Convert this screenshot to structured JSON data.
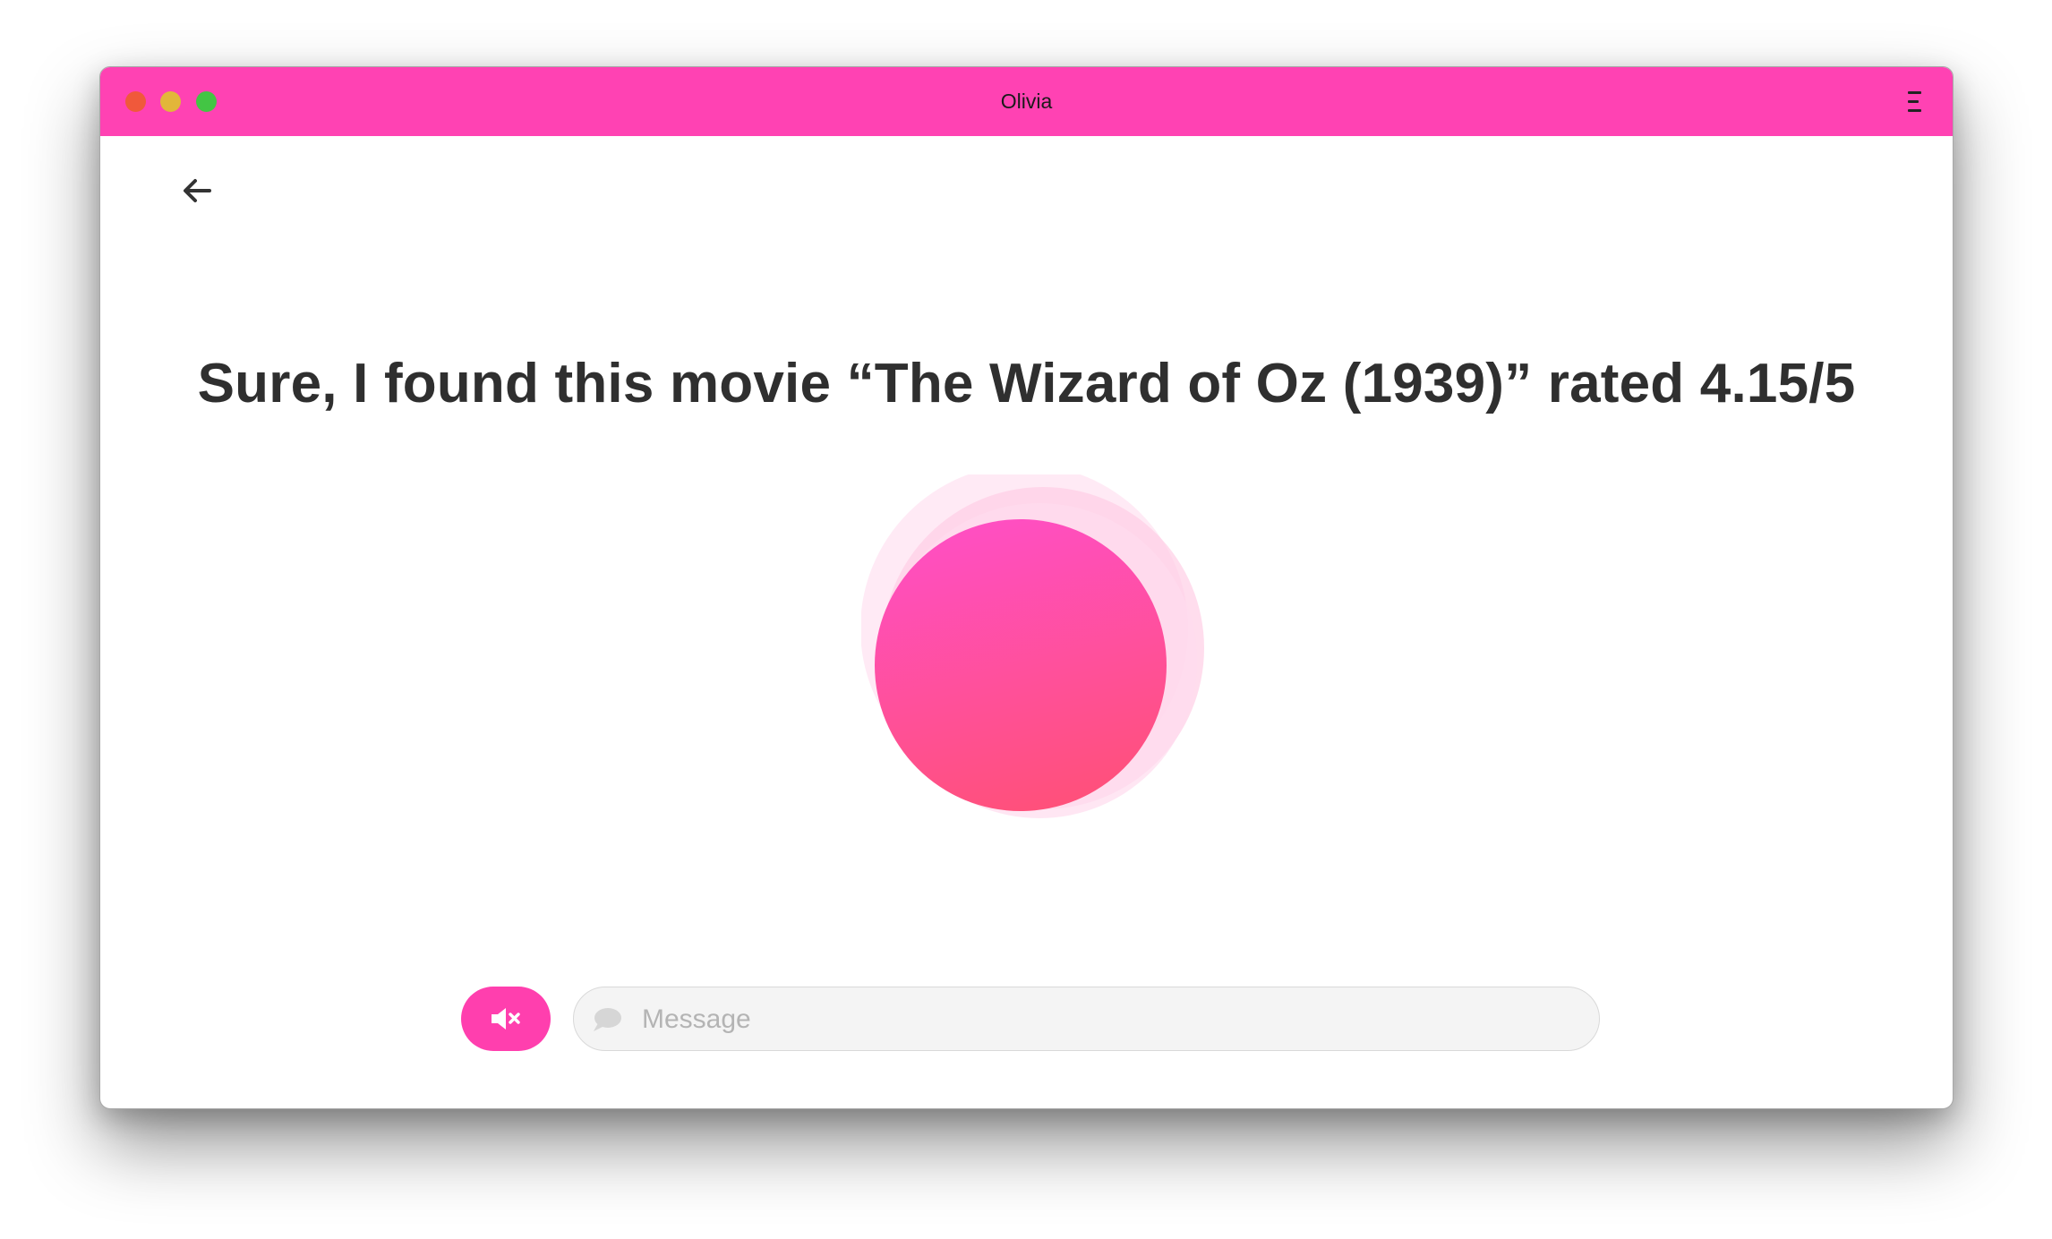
{
  "window": {
    "title": "Olivia"
  },
  "header": {
    "back_icon": "arrow-left-icon",
    "menu_icon": "hamburger-menu-icon"
  },
  "main": {
    "response_text": "Sure, I found this movie “The Wizard of Oz (1939)” rated 4.15/5",
    "orb": "voice-assistant-orb"
  },
  "composer": {
    "mute_icon": "speaker-muted-icon",
    "chat_icon": "chat-bubble-icon",
    "message_placeholder": "Message",
    "message_value": ""
  },
  "colors": {
    "accent": "#ff42b3",
    "orb_top": "#ff4fc3",
    "orb_bottom": "#ff507a",
    "traffic_close": "#f0593b",
    "traffic_minimize": "#e2b63a",
    "traffic_maximize": "#43c544",
    "headline": "#2f2f2f"
  }
}
